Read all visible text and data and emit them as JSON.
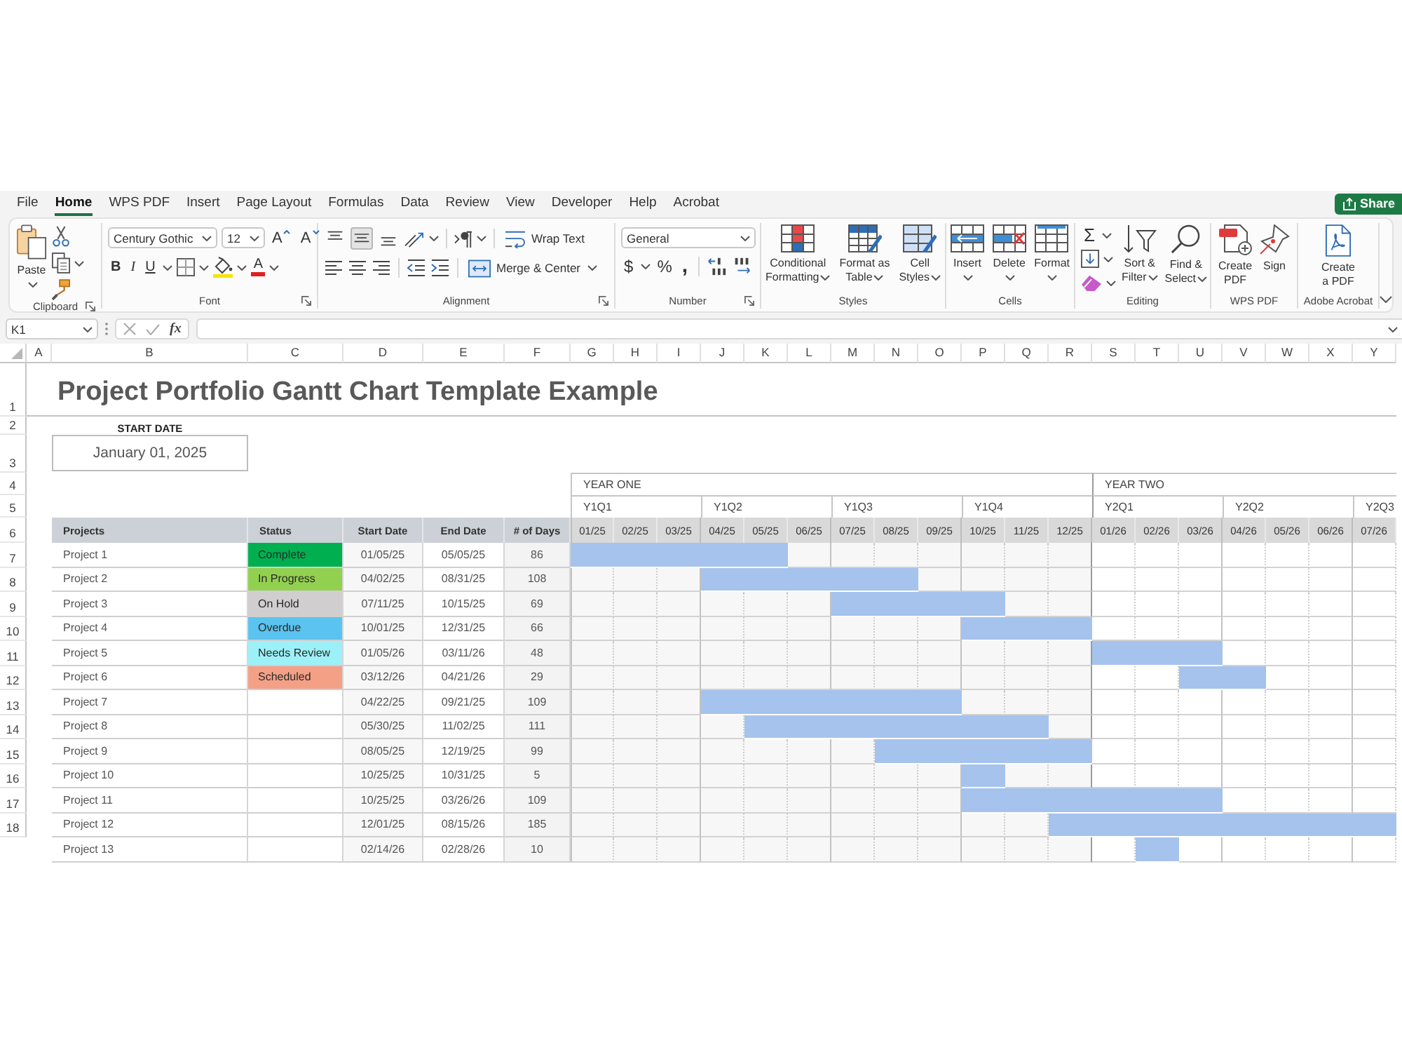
{
  "ribbon": {
    "tabs": [
      {
        "label": "File",
        "selected": false
      },
      {
        "label": "Home",
        "selected": true
      },
      {
        "label": "WPS PDF",
        "selected": false
      },
      {
        "label": "Insert",
        "selected": false
      },
      {
        "label": "Page Layout",
        "selected": false
      },
      {
        "label": "Formulas",
        "selected": false
      },
      {
        "label": "Data",
        "selected": false
      },
      {
        "label": "Review",
        "selected": false
      },
      {
        "label": "View",
        "selected": false
      },
      {
        "label": "Developer",
        "selected": false
      },
      {
        "label": "Help",
        "selected": false
      },
      {
        "label": "Acrobat",
        "selected": false
      }
    ],
    "share_button": "Share",
    "clipboard": {
      "label": "Clipboard",
      "paste": "Paste"
    },
    "font": {
      "label": "Font",
      "font_name": "Century Gothic",
      "font_size": "12",
      "grow_font": "A",
      "shrink_font": "A",
      "bold": "B",
      "italic": "I",
      "underline": "U",
      "font_color": "A"
    },
    "alignment": {
      "label": "Alignment",
      "align_buttons": [
        {
          "selected": false
        },
        {
          "selected": true
        },
        {
          "selected": false
        }
      ],
      "wrap_text": "Wrap Text",
      "merge_center": "Merge & Center"
    },
    "number": {
      "label": "Number",
      "format": "General",
      "currency": "$",
      "percent": "%",
      "comma": ","
    },
    "styles": {
      "label": "Styles",
      "buttons": [
        {
          "label_lines": [
            "Conditional",
            "Formatting"
          ]
        },
        {
          "label_lines": [
            "Format as",
            "Table"
          ]
        },
        {
          "label_lines": [
            "Cell",
            "Styles"
          ]
        }
      ]
    },
    "cells": {
      "label": "Cells",
      "buttons": [
        {
          "label_lines": [
            "Insert"
          ]
        },
        {
          "label_lines": [
            "Delete"
          ]
        },
        {
          "label_lines": [
            "Format"
          ]
        }
      ]
    },
    "editing": {
      "label": "Editing",
      "autosum": "Σ",
      "buttons": [
        {
          "label_lines": [
            "Sort &",
            "Filter"
          ]
        },
        {
          "label_lines": [
            "Find &",
            "Select"
          ]
        }
      ]
    },
    "wps_pdf": {
      "label": "WPS PDF",
      "buttons": [
        {
          "label_lines": [
            "Create",
            "PDF"
          ]
        },
        {
          "label_lines": [
            "Sign"
          ]
        }
      ]
    },
    "acrobat": {
      "label": "Adobe Acrobat",
      "buttons": [
        {
          "label_lines": [
            "Create",
            "a PDF"
          ]
        }
      ]
    }
  },
  "formula_bar": {
    "name_box": "K1",
    "function_label": "fx"
  },
  "sheet": {
    "column_headers": [
      "A",
      "B",
      "C",
      "D",
      "E",
      "F",
      "G",
      "H",
      "I",
      "J",
      "K",
      "L",
      "M",
      "N",
      "O",
      "P",
      "Q",
      "R",
      "S",
      "T",
      "U",
      "V",
      "W",
      "X",
      "Y"
    ],
    "row_numbers": [
      "1",
      "2",
      "3",
      "4",
      "5",
      "6",
      "7",
      "8",
      "9",
      "10",
      "11",
      "12",
      "13",
      "14",
      "15",
      "16",
      "17",
      "18"
    ],
    "title": "Project Portfolio Gantt Chart Template Example",
    "start_date": {
      "label": "START DATE",
      "value": "January 01, 2025"
    },
    "timeline": {
      "years": [
        "YEAR ONE",
        "YEAR TWO"
      ],
      "quarters": [
        "Y1Q1",
        "Y1Q2",
        "Y1Q3",
        "Y1Q4",
        "Y2Q1",
        "Y2Q2",
        "Y2Q3"
      ],
      "months": [
        "01/25",
        "02/25",
        "03/25",
        "04/25",
        "05/25",
        "06/25",
        "07/25",
        "08/25",
        "09/25",
        "10/25",
        "11/25",
        "12/25",
        "01/26",
        "02/26",
        "03/26",
        "04/26",
        "05/26",
        "06/26",
        "07/26"
      ]
    },
    "table": {
      "columns": [
        "Projects",
        "Status",
        "Start Date",
        "End Date",
        "# of Days"
      ],
      "rows": [
        {
          "project": "Project 1",
          "status": "Complete",
          "color": "#00b050",
          "start_date": "01/05/25",
          "end_date": "05/05/25",
          "days": "86"
        },
        {
          "project": "Project 2",
          "status": "In Progress",
          "color": "#92d050",
          "start_date": "04/02/25",
          "end_date": "08/31/25",
          "days": "108"
        },
        {
          "project": "Project 3",
          "status": "On Hold",
          "color": "#d0cece",
          "start_date": "07/11/25",
          "end_date": "10/15/25",
          "days": "69"
        },
        {
          "project": "Project 4",
          "status": "Overdue",
          "color": "#5ac3ef",
          "start_date": "10/01/25",
          "end_date": "12/31/25",
          "days": "66"
        },
        {
          "project": "Project 5",
          "status": "Needs Review",
          "color": "#9cf1f8",
          "start_date": "01/05/26",
          "end_date": "03/11/26",
          "days": "48"
        },
        {
          "project": "Project 6",
          "status": "Scheduled",
          "color": "#f4a086",
          "start_date": "03/12/26",
          "end_date": "04/21/26",
          "days": "29"
        },
        {
          "project": "Project 7",
          "start_date": "04/22/25",
          "end_date": "09/21/25",
          "days": "109"
        },
        {
          "project": "Project 8",
          "start_date": "05/30/25",
          "end_date": "11/02/25",
          "days": "111"
        },
        {
          "project": "Project 9",
          "start_date": "08/05/25",
          "end_date": "12/19/25",
          "days": "99"
        },
        {
          "project": "Project 10",
          "start_date": "10/25/25",
          "end_date": "10/31/25",
          "days": "5"
        },
        {
          "project": "Project 11",
          "start_date": "10/25/25",
          "end_date": "03/26/26",
          "days": "109"
        },
        {
          "project": "Project 12",
          "start_date": "12/01/25",
          "end_date": "08/15/26",
          "days": "185"
        },
        {
          "project": "Project 13",
          "start_date": "02/14/26",
          "end_date": "02/28/26",
          "days": "10"
        }
      ]
    }
  }
}
